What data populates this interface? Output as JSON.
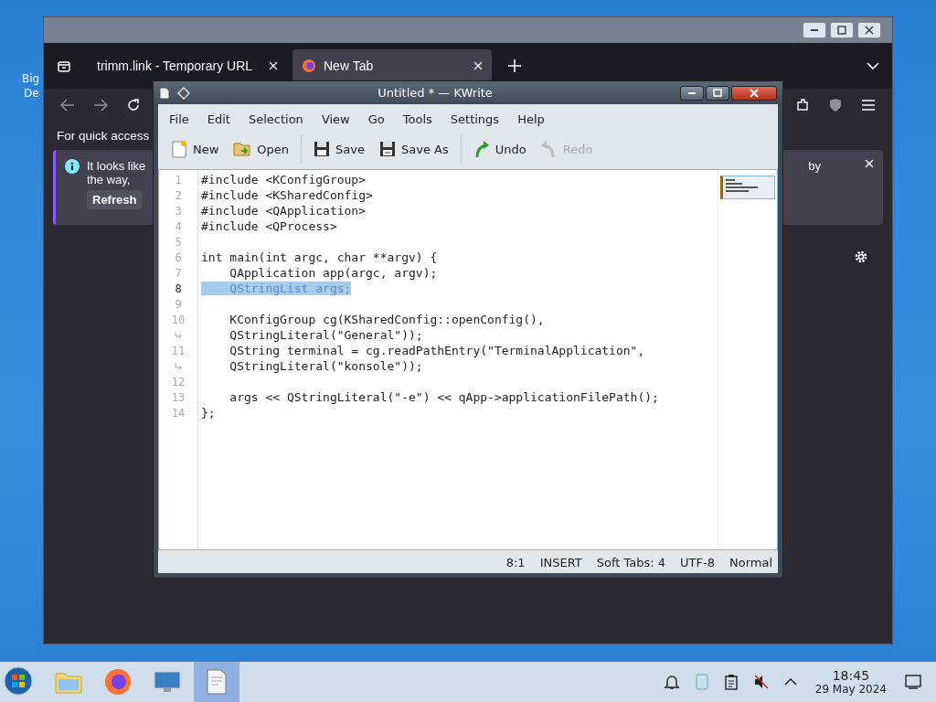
{
  "desktop": {
    "icon_label": "Big",
    "icon_label_2": "De"
  },
  "browser": {
    "tabs": [
      {
        "label": "trimm.link - Temporary URL",
        "selected": false
      },
      {
        "label": "New Tab",
        "selected": true
      }
    ],
    "quick_access_text": "For quick access",
    "notice": {
      "line_1": "It looks like",
      "line_2": "the way,",
      "line_end": "by",
      "button": "Refresh"
    }
  },
  "editor": {
    "title": "Untitled * — KWrite",
    "menu": [
      "File",
      "Edit",
      "Selection",
      "View",
      "Go",
      "Tools",
      "Settings",
      "Help"
    ],
    "toolbar": [
      {
        "kind": "new",
        "label": "New",
        "disabled": false
      },
      {
        "kind": "open",
        "label": "Open",
        "disabled": false
      },
      {
        "kind": "save",
        "label": "Save",
        "disabled": false
      },
      {
        "kind": "saveas",
        "label": "Save As",
        "disabled": false
      },
      {
        "kind": "undo",
        "label": "Undo",
        "disabled": false
      },
      {
        "kind": "redo",
        "label": "Redo",
        "disabled": true
      }
    ],
    "lines": [
      {
        "kind": "line",
        "number": "1",
        "text": "#include <KConfigGroup>",
        "selected": false
      },
      {
        "kind": "line",
        "number": "2",
        "text": "#include <KSharedConfig>",
        "selected": false
      },
      {
        "kind": "line",
        "number": "3",
        "text": "#include <QApplication>",
        "selected": false
      },
      {
        "kind": "line",
        "number": "4",
        "text": "#include <QProcess>",
        "selected": false
      },
      {
        "kind": "line",
        "number": "5",
        "selected": false
      },
      {
        "kind": "line",
        "number": "6",
        "text": "int main(int argc, char **argv) {",
        "selected": false
      },
      {
        "kind": "line",
        "number": "7",
        "text": "    QApplication app(argc, argv);",
        "selected": false
      },
      {
        "kind": "line",
        "number": "8",
        "text": "    QStringList args;",
        "selected": true
      },
      {
        "kind": "line",
        "number": "9",
        "selected": false
      },
      {
        "kind": "line",
        "number": "10",
        "text": "    KConfigGroup cg(KSharedConfig::openConfig(),",
        "selected": false
      },
      {
        "kind": "wrap",
        "text": "    QStringLiteral(\"General\"));",
        "selected": false
      },
      {
        "kind": "line",
        "number": "11",
        "text": "    QString terminal = cg.readPathEntry(\"TerminalApplication\",",
        "selected": false
      },
      {
        "kind": "wrap",
        "text": "    QStringLiteral(\"konsole\"));",
        "selected": false
      },
      {
        "kind": "line",
        "number": "12",
        "selected": false
      },
      {
        "kind": "line",
        "number": "13",
        "text": "    args << QStringLiteral(\"-e\") << qApp->applicationFilePath();",
        "selected": false
      },
      {
        "kind": "line",
        "number": "14",
        "text": "};",
        "selected": false
      }
    ],
    "status": [
      "8:1",
      "INSERT",
      "Soft Tabs: 4",
      "UTF-8",
      "Normal"
    ]
  },
  "taskbar": {
    "apps": [
      {
        "kind": "files",
        "selected": false
      },
      {
        "kind": "firefox",
        "selected": false
      },
      {
        "kind": "monitor",
        "selected": false
      },
      {
        "kind": "kwrite",
        "selected": true
      }
    ],
    "time": "18:45",
    "date": "29 May 2024"
  }
}
